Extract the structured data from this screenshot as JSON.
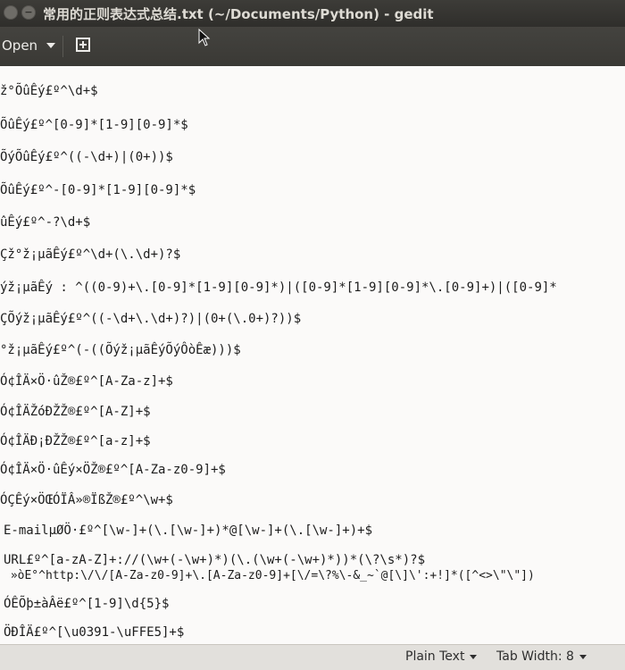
{
  "window": {
    "title": "常用的正则表达式总结.txt (~/Documents/Python) - gedit"
  },
  "toolbar": {
    "open_label": "Open"
  },
  "editor": {
    "lines": [
      "ž°ÕûÊý£º^\\d+$",
      "ÕûÊý£º^[0-9]*[1-9][0-9]*$",
      "ÕýÕûÊý£º^((-\\d+)|(0+))$",
      "ÕûÊý£º^-[0-9]*[1-9][0-9]*$",
      "ûÊý£º^-?\\d+$",
      "Çž°ž¡µãÊý£º^\\d+(\\.\\d+)?$",
      "ýž¡µãÊý : ^((0-9)+\\.[0-9]*[1-9][0-9]*)|([0-9]*[1-9][0-9]*\\.[0-9]+)|([0-9]*",
      "ÇÕýž¡µãÊý£º^((-\\d+\\.\\d+)?)|(0+(\\.0+)?))$",
      "°ž¡µãÊý£º^(-((Õýž¡µãÊýÕýÔòÊæ)))$",
      "Ó¢ÎÄ×Ö·ûŽ®£º^[A-Za-z]+$",
      "Ó¢ÎÄŽóÐŽŽ®£º^[A-Z]+$",
      "Ó¢ÎÄÐ¡ÐŽŽ®£º^[a-z]+$",
      "Ó¢ÎÄ×Ö·ûÊý×ÖŽ®£º^[A-Za-z0-9]+$",
      "ÓÇÊý×ÖŒÓÏÂ»®ÏßŽ®£º^\\w+$",
      "E-mailµØÖ·£º^[\\w-]+(\\.[\\w-]+)*@[\\w-]+(\\.[\\w-]+)+$",
      "URL£º^[a-zA-Z]+://(\\w+(-\\w+)*)(\\.(\\w+(-\\w+)*))*(\\?\\s*)?$",
      " »òE°^http:\\/\\/[A-Za-z0-9]+\\.[A-Za-z0-9]+[\\/=\\?%\\-&_~`@[\\]\\':+!]*([^<>\\\"\\\"])",
      "ÓÊÕþ±àÂë£º^[1-9]\\d{5}$",
      "ÖÐÎÄ£º^[\\u0391-\\uFFE5]+$"
    ]
  },
  "statusbar": {
    "language": "Plain Text",
    "tab_width": "Tab Width: 8"
  }
}
